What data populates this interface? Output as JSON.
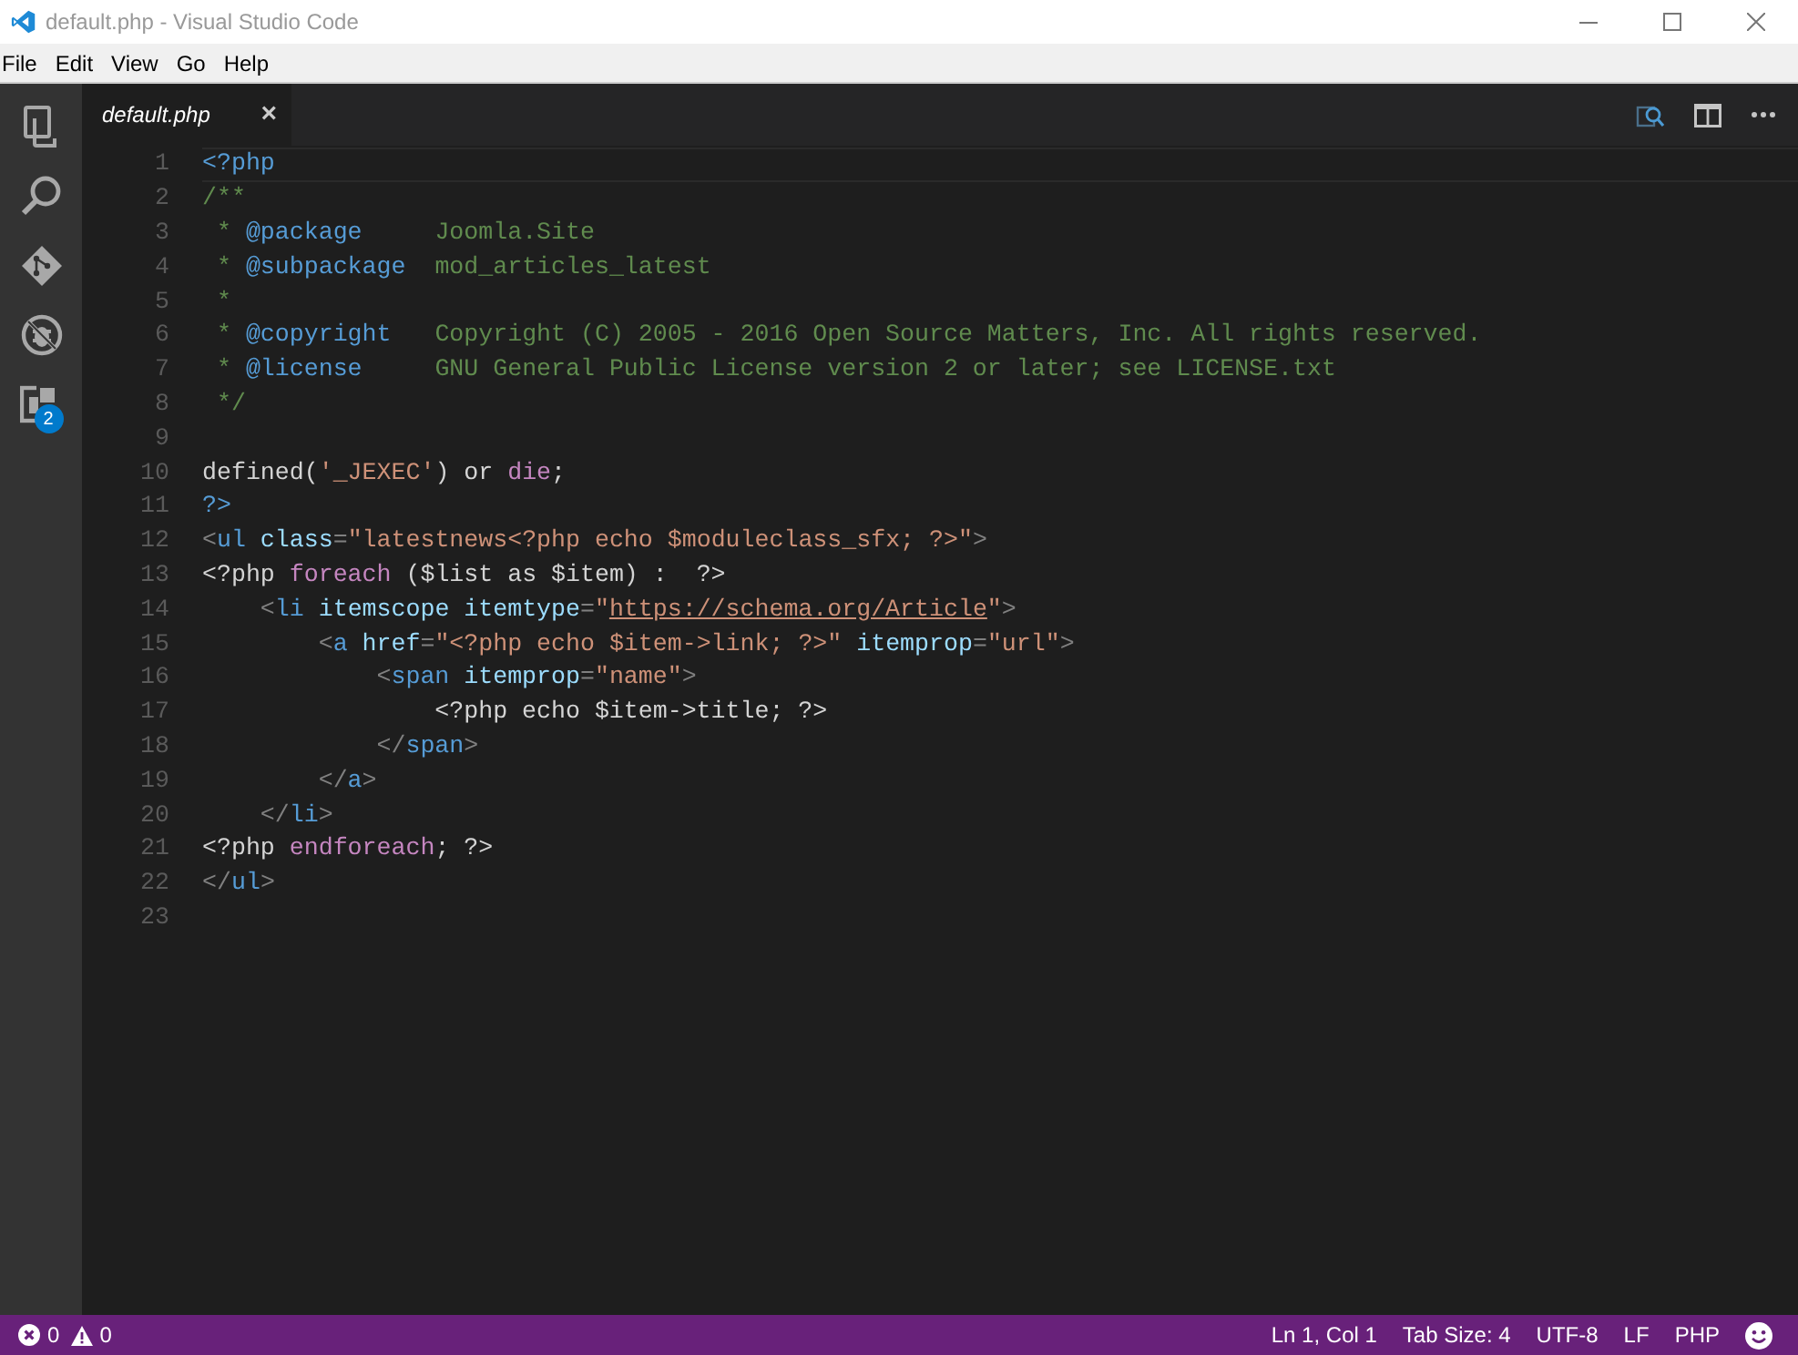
{
  "window": {
    "title": "default.php - Visual Studio Code"
  },
  "menu": [
    "File",
    "Edit",
    "View",
    "Go",
    "Help"
  ],
  "activity_bar": [
    {
      "kind": "files",
      "selected": false
    },
    {
      "kind": "search",
      "selected": false
    },
    {
      "kind": "git",
      "selected": false
    },
    {
      "kind": "debug",
      "selected": false
    },
    {
      "kind": "extensions",
      "selected": false,
      "badge": "2"
    }
  ],
  "tabs": [
    {
      "label": "default.php",
      "selected": true,
      "close": "×"
    }
  ],
  "editor": {
    "lines": [
      {
        "number": "1",
        "current": true,
        "tokens": [
          {
            "text": "<?php",
            "kind": "tag"
          }
        ]
      },
      {
        "number": "2",
        "current": false,
        "tokens": [
          {
            "text": "/**",
            "kind": "comment"
          }
        ]
      },
      {
        "number": "3",
        "current": false,
        "tokens": [
          {
            "text": " * ",
            "kind": "comment"
          },
          {
            "text": "@package",
            "kind": "doctag"
          },
          {
            "text": "     Joomla.Site",
            "kind": "comment"
          }
        ]
      },
      {
        "number": "4",
        "current": false,
        "tokens": [
          {
            "text": " * ",
            "kind": "comment"
          },
          {
            "text": "@subpackage",
            "kind": "doctag"
          },
          {
            "text": "  mod_articles_latest",
            "kind": "comment"
          }
        ]
      },
      {
        "number": "5",
        "current": false,
        "tokens": [
          {
            "text": " *",
            "kind": "comment"
          }
        ]
      },
      {
        "number": "6",
        "current": false,
        "tokens": [
          {
            "text": " * ",
            "kind": "comment"
          },
          {
            "text": "@copyright",
            "kind": "doctag"
          },
          {
            "text": "   Copyright (C) 2005 - 2016 Open Source Matters, Inc. All rights reserved.",
            "kind": "comment"
          }
        ]
      },
      {
        "number": "7",
        "current": false,
        "tokens": [
          {
            "text": " * ",
            "kind": "comment"
          },
          {
            "text": "@license",
            "kind": "doctag"
          },
          {
            "text": "     GNU General Public License version 2 or later; see LICENSE.txt",
            "kind": "comment"
          }
        ]
      },
      {
        "number": "8",
        "current": false,
        "tokens": [
          {
            "text": " */",
            "kind": "comment"
          }
        ]
      },
      {
        "number": "9",
        "current": false
      },
      {
        "number": "10",
        "current": false,
        "tokens": [
          {
            "text": "defined(",
            "kind": "plain"
          },
          {
            "text": "'_JEXEC'",
            "kind": "string"
          },
          {
            "text": ") or ",
            "kind": "plain"
          },
          {
            "text": "die",
            "kind": "keyword"
          },
          {
            "text": ";",
            "kind": "plain"
          }
        ]
      },
      {
        "number": "11",
        "current": false,
        "tokens": [
          {
            "text": "?>",
            "kind": "tag"
          }
        ]
      },
      {
        "number": "12",
        "current": false,
        "tokens": [
          {
            "text": "<",
            "kind": "punct"
          },
          {
            "text": "ul",
            "kind": "tag"
          },
          {
            "text": " class",
            "kind": "attr"
          },
          {
            "text": "=",
            "kind": "punct"
          },
          {
            "text": "\"latestnews<?php echo $moduleclass_sfx; ?>\"",
            "kind": "string"
          },
          {
            "text": ">",
            "kind": "punct"
          }
        ]
      },
      {
        "number": "13",
        "current": false,
        "tokens": [
          {
            "text": "<?php ",
            "kind": "plain"
          },
          {
            "text": "foreach",
            "kind": "keyword"
          },
          {
            "text": " ($list as $item) :  ?>",
            "kind": "plain"
          }
        ]
      },
      {
        "number": "14",
        "current": false,
        "tokens": [
          {
            "text": "    <",
            "kind": "punct"
          },
          {
            "text": "li",
            "kind": "tag"
          },
          {
            "text": " itemscope itemtype",
            "kind": "attr"
          },
          {
            "text": "=",
            "kind": "punct"
          },
          {
            "text": "\"",
            "kind": "string"
          },
          {
            "text": "https://schema.org/Article",
            "kind": "link"
          },
          {
            "text": "\"",
            "kind": "string"
          },
          {
            "text": ">",
            "kind": "punct"
          }
        ]
      },
      {
        "number": "15",
        "current": false,
        "tokens": [
          {
            "text": "        <",
            "kind": "punct"
          },
          {
            "text": "a",
            "kind": "tag"
          },
          {
            "text": " href",
            "kind": "attr"
          },
          {
            "text": "=",
            "kind": "punct"
          },
          {
            "text": "\"<?php echo $item->link; ?>\"",
            "kind": "string"
          },
          {
            "text": " itemprop",
            "kind": "attr"
          },
          {
            "text": "=",
            "kind": "punct"
          },
          {
            "text": "\"url\"",
            "kind": "string"
          },
          {
            "text": ">",
            "kind": "punct"
          }
        ]
      },
      {
        "number": "16",
        "current": false,
        "tokens": [
          {
            "text": "            <",
            "kind": "punct"
          },
          {
            "text": "span",
            "kind": "tag"
          },
          {
            "text": " itemprop",
            "kind": "attr"
          },
          {
            "text": "=",
            "kind": "punct"
          },
          {
            "text": "\"name\"",
            "kind": "string"
          },
          {
            "text": ">",
            "kind": "punct"
          }
        ]
      },
      {
        "number": "17",
        "current": false,
        "tokens": [
          {
            "text": "                <?php echo $item->title; ?>",
            "kind": "plain"
          }
        ]
      },
      {
        "number": "18",
        "current": false,
        "tokens": [
          {
            "text": "            </",
            "kind": "punct"
          },
          {
            "text": "span",
            "kind": "tag"
          },
          {
            "text": ">",
            "kind": "punct"
          }
        ]
      },
      {
        "number": "19",
        "current": false,
        "tokens": [
          {
            "text": "        </",
            "kind": "punct"
          },
          {
            "text": "a",
            "kind": "tag"
          },
          {
            "text": ">",
            "kind": "punct"
          }
        ]
      },
      {
        "number": "20",
        "current": false,
        "tokens": [
          {
            "text": "    </",
            "kind": "punct"
          },
          {
            "text": "li",
            "kind": "tag"
          },
          {
            "text": ">",
            "kind": "punct"
          }
        ]
      },
      {
        "number": "21",
        "current": false,
        "tokens": [
          {
            "text": "<?php ",
            "kind": "plain"
          },
          {
            "text": "endforeach",
            "kind": "keyword"
          },
          {
            "text": "; ?>",
            "kind": "plain"
          }
        ]
      },
      {
        "number": "22",
        "current": false,
        "tokens": [
          {
            "text": "</",
            "kind": "punct"
          },
          {
            "text": "ul",
            "kind": "tag"
          },
          {
            "text": ">",
            "kind": "punct"
          }
        ]
      },
      {
        "number": "23",
        "current": false
      }
    ]
  },
  "status_bar": {
    "errors": "0",
    "warnings": "0",
    "items": [
      "Ln 1, Col 1",
      "Tab Size: 4",
      "UTF-8",
      "LF",
      "PHP"
    ]
  }
}
